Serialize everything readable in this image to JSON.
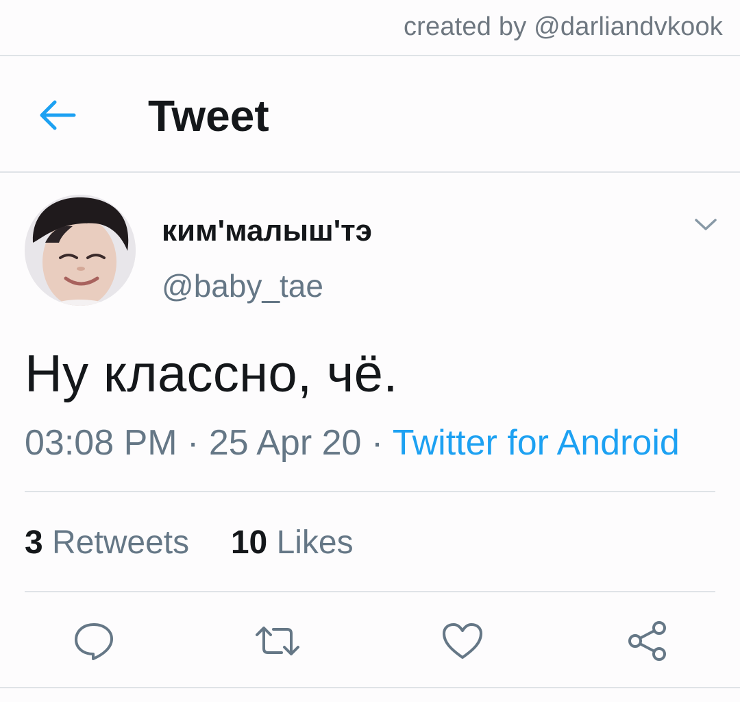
{
  "watermark": {
    "credit": "created by @darliandvkook"
  },
  "header": {
    "back_icon": "arrow-left-icon",
    "title": "Tweet"
  },
  "tweet": {
    "author": {
      "display_name": "ким'малыш'тэ",
      "handle": "@baby_tae",
      "avatar": "profile-photo"
    },
    "text": "Ну классно, чё.",
    "time": "03:08 PM",
    "separator": "·",
    "date": "25 Apr 20",
    "source": "Twitter for Android",
    "stats": {
      "retweets_count": "3",
      "retweets_label": "Retweets",
      "likes_count": "10",
      "likes_label": "Likes"
    }
  },
  "actions": {
    "reply_icon": "reply-icon",
    "retweet_icon": "retweet-icon",
    "like_icon": "heart-icon",
    "share_icon": "share-icon"
  },
  "colors": {
    "accent": "#1da1f2",
    "secondary_text": "#657786",
    "primary_text": "#14171a",
    "divider": "#dfe3e7"
  }
}
